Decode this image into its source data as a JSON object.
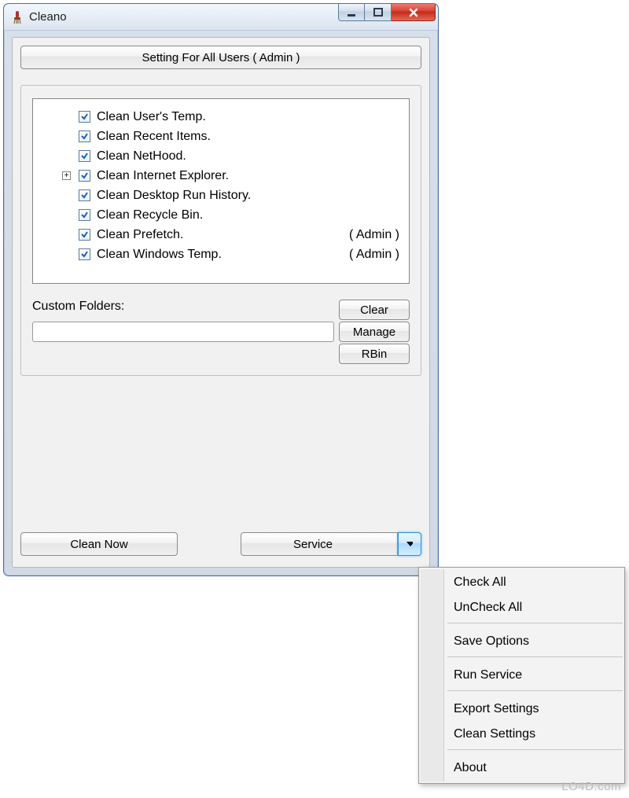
{
  "title": "Cleano",
  "setting_button": "Setting For All Users  ( Admin )",
  "tree_items": [
    {
      "label": "Clean User's Temp.",
      "checked": true,
      "expander": false,
      "suffix": ""
    },
    {
      "label": "Clean Recent Items.",
      "checked": true,
      "expander": false,
      "suffix": ""
    },
    {
      "label": "Clean NetHood.",
      "checked": true,
      "expander": false,
      "suffix": ""
    },
    {
      "label": "Clean Internet Explorer.",
      "checked": true,
      "expander": true,
      "suffix": ""
    },
    {
      "label": "Clean Desktop Run History.",
      "checked": true,
      "expander": false,
      "suffix": ""
    },
    {
      "label": "Clean Recycle Bin.",
      "checked": true,
      "expander": false,
      "suffix": ""
    },
    {
      "label": "Clean Prefetch.",
      "checked": true,
      "expander": false,
      "suffix": "( Admin )"
    },
    {
      "label": "Clean Windows Temp.",
      "checked": true,
      "expander": false,
      "suffix": "( Admin )"
    }
  ],
  "custom_folders_label": "Custom Folders:",
  "custom_folders_value": "",
  "buttons": {
    "clear": "Clear",
    "manage": "Manage",
    "rbin": "RBin",
    "clean_now": "Clean  Now",
    "service": "Service"
  },
  "menu": [
    "Check All",
    "UnCheck All",
    "-",
    "Save Options",
    "-",
    "Run Service",
    "-",
    "Export Settings",
    "Clean Settings",
    "-",
    "About"
  ],
  "watermark": "LO4D.com"
}
